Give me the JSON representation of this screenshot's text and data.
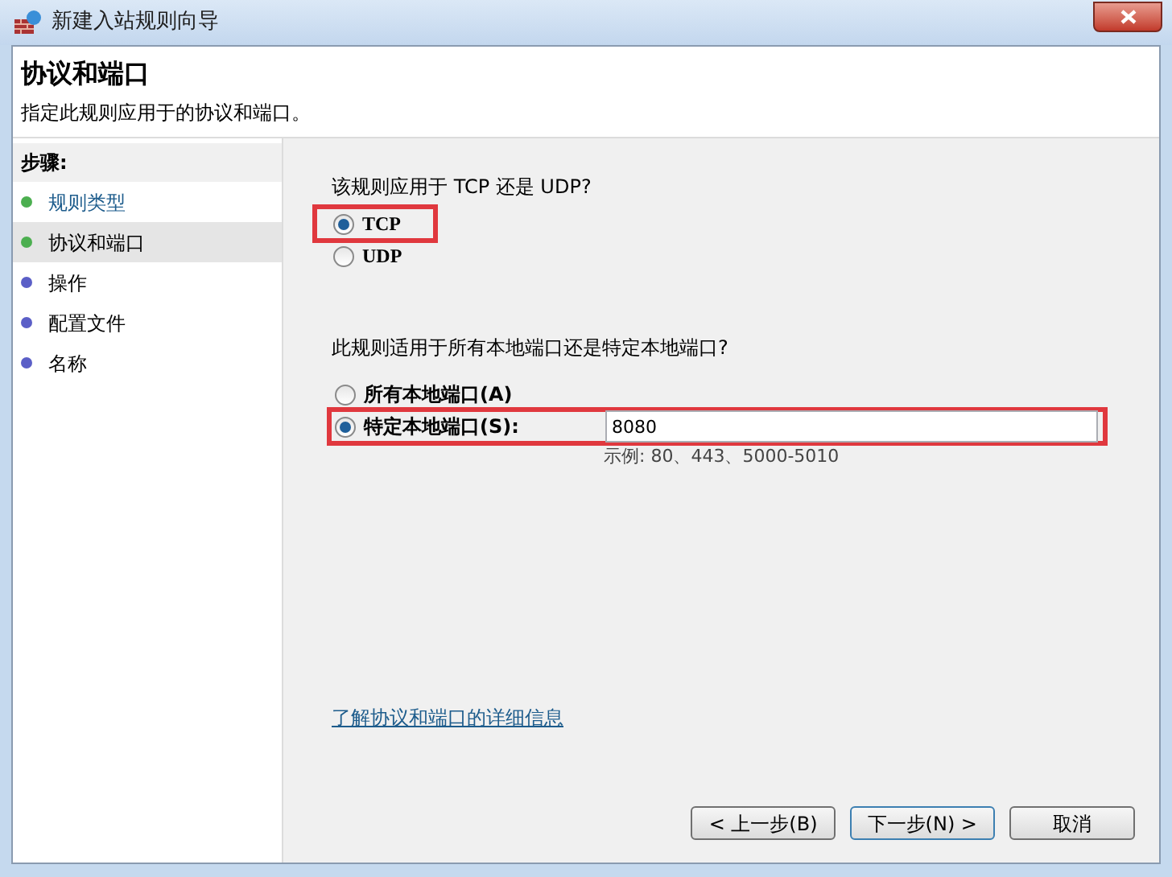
{
  "window": {
    "title": "新建入站规则向导"
  },
  "header": {
    "title": "协议和端口",
    "subtitle": "指定此规则应用于的协议和端口。"
  },
  "steps": {
    "heading": "步骤:",
    "items": [
      {
        "label": "规则类型",
        "selected": false,
        "color": "#4caf50",
        "kind": "link"
      },
      {
        "label": "协议和端口",
        "selected": true,
        "color": "#4caf50",
        "kind": "text"
      },
      {
        "label": "操作",
        "selected": false,
        "color": "#5b5fc7",
        "kind": "text"
      },
      {
        "label": "配置文件",
        "selected": false,
        "color": "#5b5fc7",
        "kind": "text"
      },
      {
        "label": "名称",
        "selected": false,
        "color": "#5b5fc7",
        "kind": "text"
      }
    ]
  },
  "protocol": {
    "question": "该规则应用于 TCP 还是 UDP?",
    "options": [
      {
        "label": "TCP",
        "selected": true,
        "highlighted": true
      },
      {
        "label": "UDP",
        "selected": false,
        "highlighted": false
      }
    ]
  },
  "ports": {
    "question": "此规则适用于所有本地端口还是特定本地端口?",
    "options": [
      {
        "label": "所有本地端口(A)",
        "selected": false,
        "highlighted": false,
        "kind": "plain"
      },
      {
        "label": "特定本地端口(S):",
        "selected": true,
        "highlighted": true,
        "kind": "input",
        "value": "8080",
        "hint": "示例: 80、443、5000-5010"
      }
    ]
  },
  "link": "了解协议和端口的详细信息",
  "buttons": [
    {
      "label": "< 上一步(B)",
      "default": false
    },
    {
      "label": "下一步(N) >",
      "default": true
    },
    {
      "label": "取消",
      "default": false
    }
  ]
}
